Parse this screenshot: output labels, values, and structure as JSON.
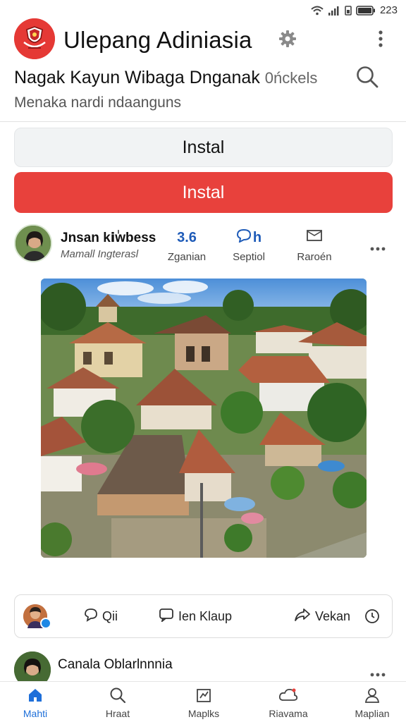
{
  "status_bar": {
    "time": "223"
  },
  "header": {
    "title": "Ulepang Adiniasia"
  },
  "subheader": {
    "heading": "Nagak Kayun Wibaga Dnganak",
    "heading_suffix": "0ńckels",
    "caption": "Menaka nardi ndaanguns"
  },
  "buttons": {
    "secondary_label": "Instal",
    "primary_label": "Instal"
  },
  "post": {
    "author": "Jnsan kiٰwbess",
    "author_sub": "Mamall Ingterasl",
    "stats": [
      {
        "top": "3.6",
        "bottom": "Zganian"
      },
      {
        "top": "h",
        "bottom": "Septiol"
      },
      {
        "top": "",
        "bottom": "Raroén"
      }
    ]
  },
  "actions": {
    "first": "Qii",
    "second": "Ien Klaup",
    "third": "Vekan"
  },
  "post2": {
    "author": "Canala Oblarlnnnia"
  },
  "nav": [
    {
      "label": "Mahti",
      "icon": "home-icon"
    },
    {
      "label": "Hraat",
      "icon": "search-icon"
    },
    {
      "label": "Maplks",
      "icon": "map-icon"
    },
    {
      "label": "Riavama",
      "icon": "cloud-icon"
    },
    {
      "label": "Maplian",
      "icon": "person-icon"
    }
  ],
  "colors": {
    "accent": "#e8413c",
    "link": "#1e5bb8",
    "active_nav": "#1e6fd9"
  }
}
